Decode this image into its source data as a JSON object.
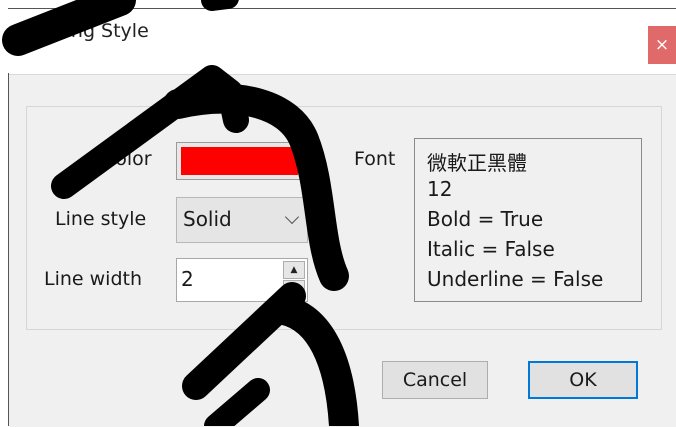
{
  "dialog": {
    "title": "Drawing Style",
    "close_glyph": "×"
  },
  "labels": {
    "color": "Color",
    "line_style": "Line style",
    "line_width": "Line width",
    "font": "Font"
  },
  "fields": {
    "color_value": "#ff0000",
    "line_style_value": "Solid",
    "line_width_value": "2"
  },
  "font_info": {
    "name": "微軟正黑體",
    "size": "12",
    "bold": "Bold = True",
    "italic": "Italic = False",
    "underline": "Underline = False"
  },
  "buttons": {
    "cancel": "Cancel",
    "ok": "OK"
  },
  "colors": {
    "annotation_pen": "#000000",
    "ok_focus": "#0078d7",
    "close_button": "#e06a6a"
  }
}
